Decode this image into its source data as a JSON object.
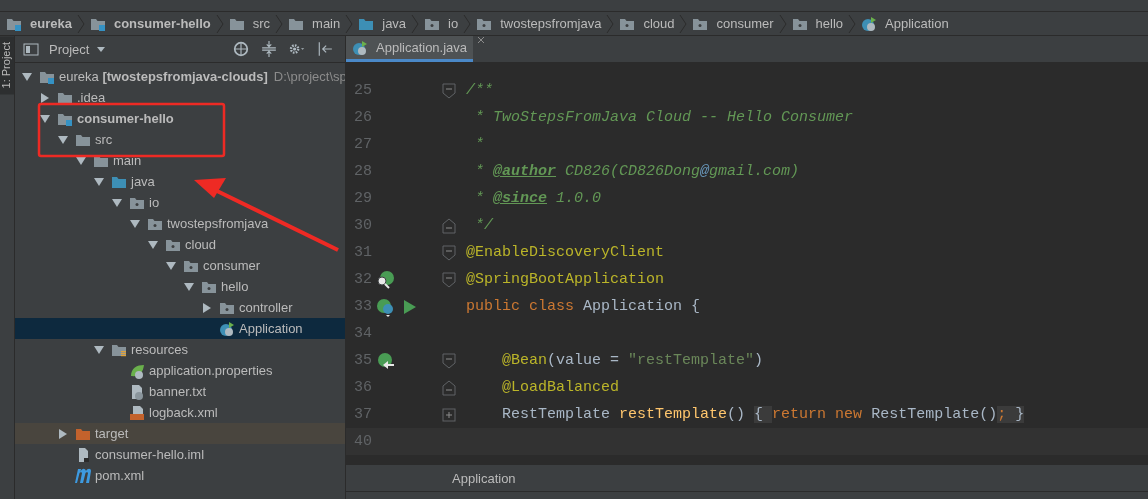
{
  "breadcrumbs": [
    {
      "label": "eureka",
      "kind": "module",
      "bold": true
    },
    {
      "label": "consumer-hello",
      "kind": "module",
      "bold": true
    },
    {
      "label": "src",
      "kind": "folder",
      "bold": false
    },
    {
      "label": "main",
      "kind": "folder",
      "bold": false
    },
    {
      "label": "java",
      "kind": "source",
      "bold": false
    },
    {
      "label": "io",
      "kind": "package",
      "bold": false
    },
    {
      "label": "twostepsfromjava",
      "kind": "package",
      "bold": false
    },
    {
      "label": "cloud",
      "kind": "package",
      "bold": false
    },
    {
      "label": "consumer",
      "kind": "package",
      "bold": false
    },
    {
      "label": "hello",
      "kind": "package",
      "bold": false
    },
    {
      "label": "Application",
      "kind": "class",
      "bold": false
    }
  ],
  "side_tab": {
    "label": "1: Project",
    "selected": true
  },
  "project_panel": {
    "title": "Project",
    "tree": [
      {
        "label": "eureka **[twostepsfromjava-clouds]**",
        "path": "D:\\project\\sp",
        "kind": "module",
        "bold": false,
        "expanded": true,
        "selected": false,
        "children": [
          {
            "label": ".idea",
            "kind": "folder",
            "bold": false,
            "expanded": false,
            "selected": false
          },
          {
            "label": "consumer-hello",
            "kind": "module",
            "bold": true,
            "expanded": true,
            "selected": false,
            "children": [
              {
                "label": "src",
                "kind": "folder",
                "bold": false,
                "expanded": true,
                "selected": false,
                "children": [
                  {
                    "label": "main",
                    "kind": "folder",
                    "bold": false,
                    "expanded": true,
                    "selected": false,
                    "children": [
                      {
                        "label": "java",
                        "kind": "source",
                        "bold": false,
                        "expanded": true,
                        "selected": false,
                        "children": [
                          {
                            "label": "io",
                            "kind": "package",
                            "bold": false,
                            "expanded": true,
                            "selected": false,
                            "children": [
                              {
                                "label": "twostepsfromjava",
                                "kind": "package",
                                "bold": false,
                                "expanded": true,
                                "selected": false,
                                "children": [
                                  {
                                    "label": "cloud",
                                    "kind": "package",
                                    "bold": false,
                                    "expanded": true,
                                    "selected": false,
                                    "children": [
                                      {
                                        "label": "consumer",
                                        "kind": "package",
                                        "bold": false,
                                        "expanded": true,
                                        "selected": false,
                                        "children": [
                                          {
                                            "label": "hello",
                                            "kind": "package",
                                            "bold": false,
                                            "expanded": true,
                                            "selected": false,
                                            "children": [
                                              {
                                                "label": "controller",
                                                "kind": "package",
                                                "bold": false,
                                                "expanded": false,
                                                "selected": false
                                              },
                                              {
                                                "label": "Application",
                                                "kind": "class",
                                                "bold": false,
                                                "selected": true
                                              }
                                            ]
                                          }
                                        ]
                                      }
                                    ]
                                  }
                                ]
                              }
                            ]
                          }
                        ]
                      },
                      {
                        "label": "resources",
                        "kind": "resources",
                        "bold": false,
                        "expanded": true,
                        "selected": false,
                        "children": [
                          {
                            "label": "application.properties",
                            "kind": "properties",
                            "bold": false,
                            "selected": false
                          },
                          {
                            "label": "banner.txt",
                            "kind": "text",
                            "bold": false,
                            "selected": false
                          },
                          {
                            "label": "logback.xml",
                            "kind": "xml",
                            "bold": false,
                            "selected": false
                          }
                        ]
                      }
                    ]
                  }
                ]
              },
              {
                "label": "target",
                "kind": "excluded",
                "bold": false,
                "expanded": false,
                "selected": false
              },
              {
                "label": "consumer-hello.iml",
                "kind": "iml",
                "bold": false,
                "selected": false
              },
              {
                "label": "pom.xml",
                "kind": "maven",
                "bold": false,
                "selected": false
              }
            ]
          }
        ]
      }
    ]
  },
  "editor": {
    "tabs": [
      {
        "label": "Application.java",
        "kind": "class",
        "selected": true
      }
    ],
    "lines": [
      {
        "number": "25",
        "fold_marker": {
          "kind": "open"
        },
        "tokens": [
          {
            "kind": "comment",
            "text": "/**"
          }
        ]
      },
      {
        "number": "26",
        "tokens": [
          {
            "kind": "comment",
            "text": " * TwoStepsFromJava Cloud -- Hello Consumer"
          }
        ]
      },
      {
        "number": "27",
        "tokens": [
          {
            "kind": "comment",
            "text": " *"
          }
        ]
      },
      {
        "number": "28",
        "tokens": [
          {
            "kind": "comment",
            "text": " * "
          },
          {
            "kind": "doctag",
            "text": "@author"
          },
          {
            "kind": "comment",
            "text": " CD826(CD826Dong"
          },
          {
            "kind": "at",
            "text": "@"
          },
          {
            "kind": "comment",
            "text": "gmail.com)"
          }
        ]
      },
      {
        "number": "29",
        "tokens": [
          {
            "kind": "comment",
            "text": " * "
          },
          {
            "kind": "doctag",
            "text": "@since"
          },
          {
            "kind": "comment",
            "text": " 1.0.0"
          }
        ]
      },
      {
        "number": "30",
        "fold_marker": {
          "kind": "close"
        },
        "tokens": [
          {
            "kind": "comment",
            "text": " */"
          }
        ]
      },
      {
        "number": "31",
        "fold_marker": {
          "kind": "open"
        },
        "tokens": [
          {
            "kind": "annotation",
            "text": "@EnableDiscoveryClient"
          }
        ]
      },
      {
        "number": "32",
        "fold_marker": {
          "kind": "open"
        },
        "gutter": [
          {
            "kind": "bean-search"
          }
        ],
        "tokens": [
          {
            "kind": "annotation",
            "text": "@SpringBootApplication"
          }
        ]
      },
      {
        "number": "33",
        "gutter": [
          {
            "kind": "bean-class"
          },
          {
            "kind": "run"
          }
        ],
        "tokens": [
          {
            "kind": "keyword",
            "text": "public class "
          },
          {
            "kind": "plain",
            "text": "Application {"
          }
        ]
      },
      {
        "number": "34"
      },
      {
        "number": "35",
        "fold_marker": {
          "kind": "open"
        },
        "gutter": [
          {
            "kind": "bean-navigate"
          }
        ],
        "tokens": [
          {
            "kind": "annotation",
            "text": "    @Bean"
          },
          {
            "kind": "plain",
            "text": "(value = "
          },
          {
            "kind": "string",
            "text": "\"restTemplate\""
          },
          {
            "kind": "plain",
            "text": ")"
          }
        ]
      },
      {
        "number": "36",
        "fold_marker": {
          "kind": "close"
        },
        "tokens": [
          {
            "kind": "annotation",
            "text": "    @LoadBalanced"
          }
        ]
      },
      {
        "number": "37",
        "fold_marker": {
          "kind": "collapsed"
        },
        "tokens": [
          {
            "kind": "plain",
            "text": "    RestTemplate "
          },
          {
            "kind": "method",
            "text": "restTemplate"
          },
          {
            "kind": "plain",
            "text": "() "
          },
          {
            "kind": "folded",
            "text": "{ "
          },
          {
            "kind": "keyword",
            "text": "return new "
          },
          {
            "kind": "plain",
            "text": "RestTemplate()"
          },
          {
            "kind": "folded-keyword",
            "text": "; "
          },
          {
            "kind": "folded",
            "text": "}"
          }
        ]
      },
      {
        "number": "40",
        "current": true
      }
    ],
    "breadcrumb": "Application"
  },
  "annotations": {
    "highlight_box": true,
    "arrow": true
  }
}
